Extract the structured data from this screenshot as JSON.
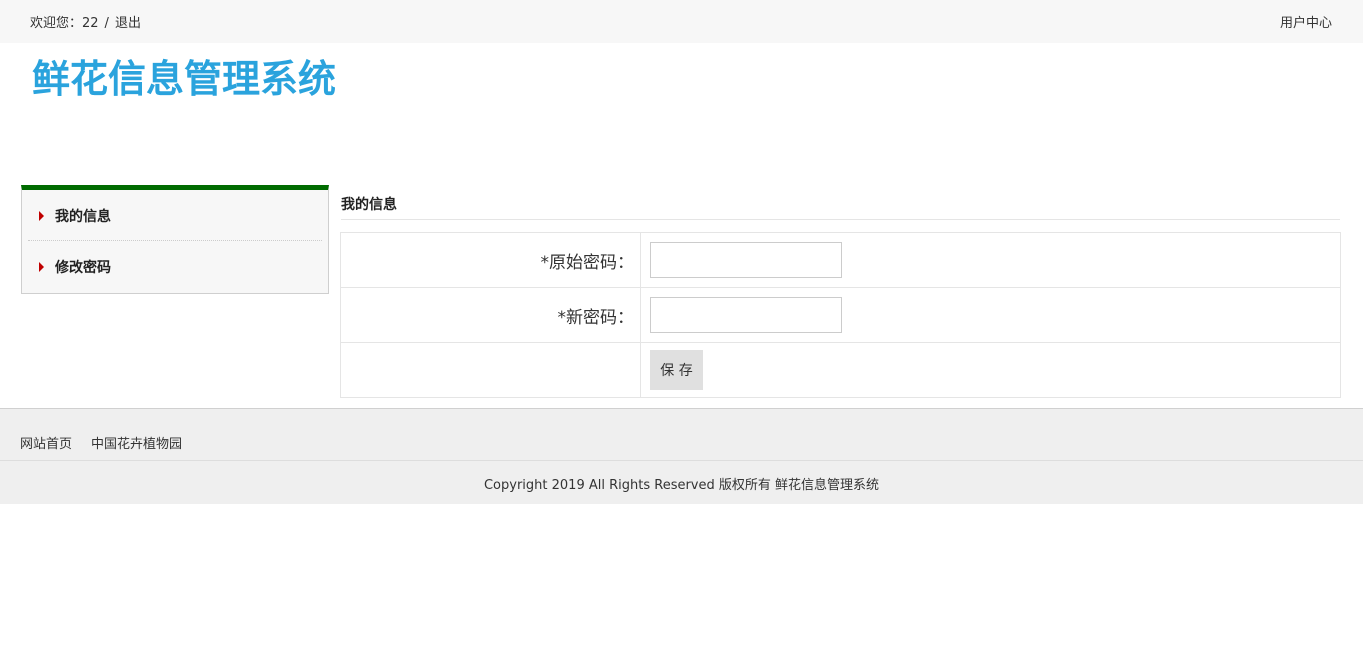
{
  "topbar": {
    "welcome_text": "欢迎您：22",
    "separator": "/",
    "logout_label": "退出",
    "user_center_label": "用户中心"
  },
  "brand": {
    "title": "鲜花信息管理系统"
  },
  "sidebar": {
    "items": [
      {
        "label": "我的信息"
      },
      {
        "label": "修改密码"
      }
    ],
    "accent_color": "#006b00",
    "bullet_color": "#c00000"
  },
  "main": {
    "section_title": "我的信息",
    "form": {
      "old_password_label": "*原始密码：",
      "old_password_value": "",
      "new_password_label": "*新密码：",
      "new_password_value": "",
      "save_label": "保 存"
    }
  },
  "footer": {
    "links": [
      {
        "label": "网站首页"
      },
      {
        "label": "中国花卉植物园"
      }
    ],
    "copyright": "Copyright 2019 All Rights Reserved 版权所有 鲜花信息管理系统"
  },
  "colors": {
    "brand": "#2aa3dd"
  }
}
